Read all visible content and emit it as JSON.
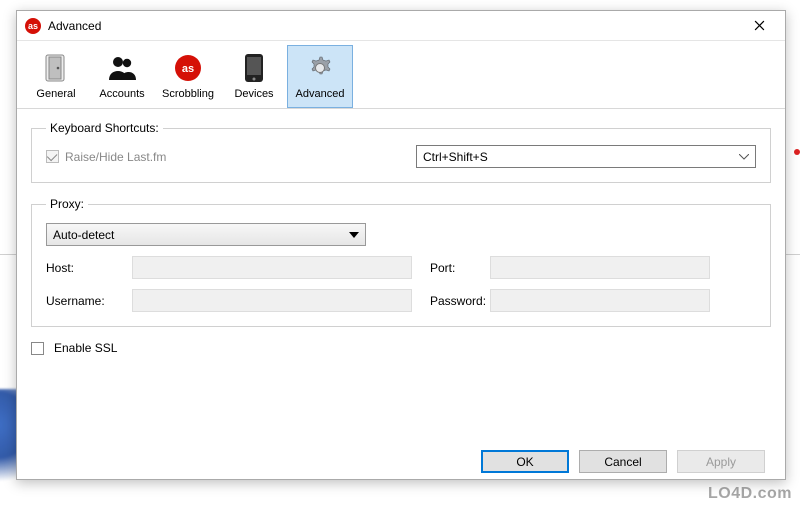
{
  "window": {
    "title": "Advanced",
    "app_icon_label": "as"
  },
  "toolbar": {
    "items": [
      {
        "label": "General"
      },
      {
        "label": "Accounts"
      },
      {
        "label": "Scrobbling"
      },
      {
        "label": "Devices"
      },
      {
        "label": "Advanced"
      }
    ]
  },
  "shortcuts": {
    "group_title": "Keyboard Shortcuts:",
    "raise_hide_label": "Raise/Hide Last.fm",
    "shortcut_value": "Ctrl+Shift+S"
  },
  "proxy": {
    "group_title": "Proxy:",
    "mode": "Auto-detect",
    "host_label": "Host:",
    "port_label": "Port:",
    "username_label": "Username:",
    "password_label": "Password:",
    "host": "",
    "port": "",
    "username": "",
    "password": ""
  },
  "ssl": {
    "label": "Enable SSL",
    "checked": false
  },
  "buttons": {
    "ok": "OK",
    "cancel": "Cancel",
    "apply": "Apply"
  },
  "watermark": "LO4D.com"
}
